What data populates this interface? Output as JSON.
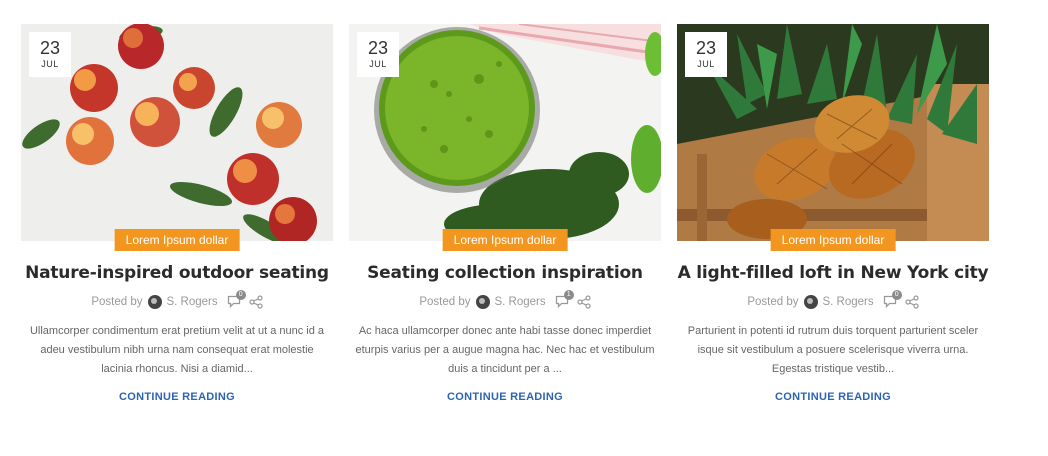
{
  "posts": [
    {
      "date_day": "23",
      "date_month": "JUL",
      "image_alt": "peaches on white surface",
      "category": "Lorem Ipsum dollar",
      "title": "Nature-inspired outdoor seating",
      "posted_by": "Posted by",
      "author": "S. Rogers",
      "comment_count": "0",
      "excerpt": "Ullamcorper condimentum erat pretium velit at ut a nunc id a adeu vestibulum nibh urna nam consequat erat molestie lacinia rhoncus. Nisi a diamid...",
      "read_more": "CONTINUE READING"
    },
    {
      "date_day": "23",
      "date_month": "JUL",
      "image_alt": "green smoothie in a glass",
      "category": "Lorem Ipsum dollar",
      "title": "Seating collection inspiration",
      "posted_by": "Posted by",
      "author": "S. Rogers",
      "comment_count": "1",
      "excerpt": "Ac haca ullamcorper donec ante habi tasse donec imperdiet eturpis varius per a augue magna hac. Nec hac et vestibulum duis a tincidunt per a ...",
      "read_more": "CONTINUE READING"
    },
    {
      "date_day": "23",
      "date_month": "JUL",
      "image_alt": "pineapples in a wooden crate",
      "category": "Lorem Ipsum dollar",
      "title": "A light-filled loft in New York city",
      "posted_by": "Posted by",
      "author": "S. Rogers",
      "comment_count": "0",
      "excerpt": "Parturient in potenti id rutrum duis torquent parturient sceler isque sit vestibulum a posuere scelerisque viverra urna. Egestas tristique vestib...",
      "read_more": "CONTINUE READING"
    }
  ],
  "colors": {
    "category_bg": "#f39620",
    "read_more": "#2d64b2",
    "title": "#2b2b2b",
    "meta": "#999999",
    "excerpt": "#666666"
  },
  "icons": {
    "comment": "comment-bubble-icon",
    "share": "share-icon",
    "avatar": "author-avatar"
  }
}
